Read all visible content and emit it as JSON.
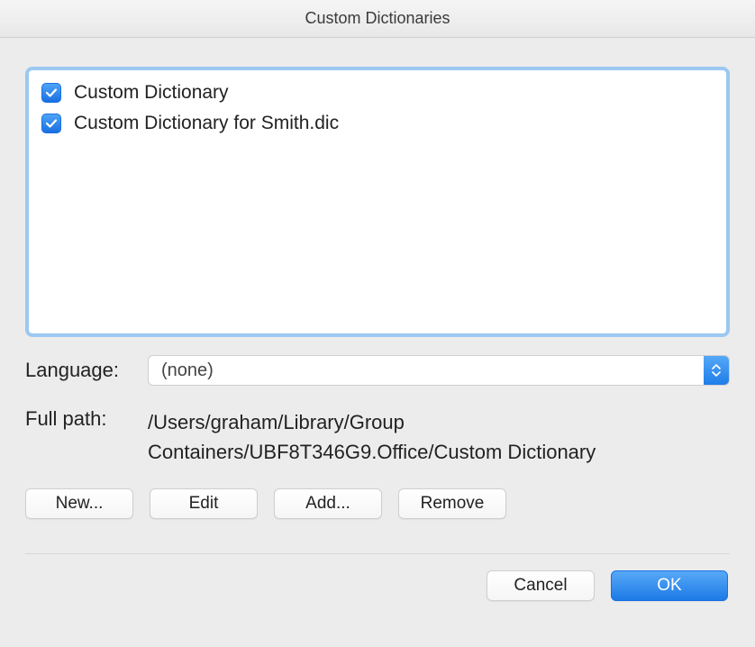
{
  "window": {
    "title": "Custom Dictionaries"
  },
  "dictionaries": {
    "items": [
      {
        "checked": true,
        "label": "Custom Dictionary"
      },
      {
        "checked": true,
        "label": "Custom Dictionary for Smith.dic"
      }
    ]
  },
  "language": {
    "label": "Language:",
    "selected": "(none)"
  },
  "fullpath": {
    "label": "Full path:",
    "value": "/Users/graham/Library/Group Containers/UBF8T346G9.Office/Custom Dictionary"
  },
  "buttons": {
    "new": "New...",
    "edit": "Edit",
    "add": "Add...",
    "remove": "Remove",
    "cancel": "Cancel",
    "ok": "OK"
  }
}
